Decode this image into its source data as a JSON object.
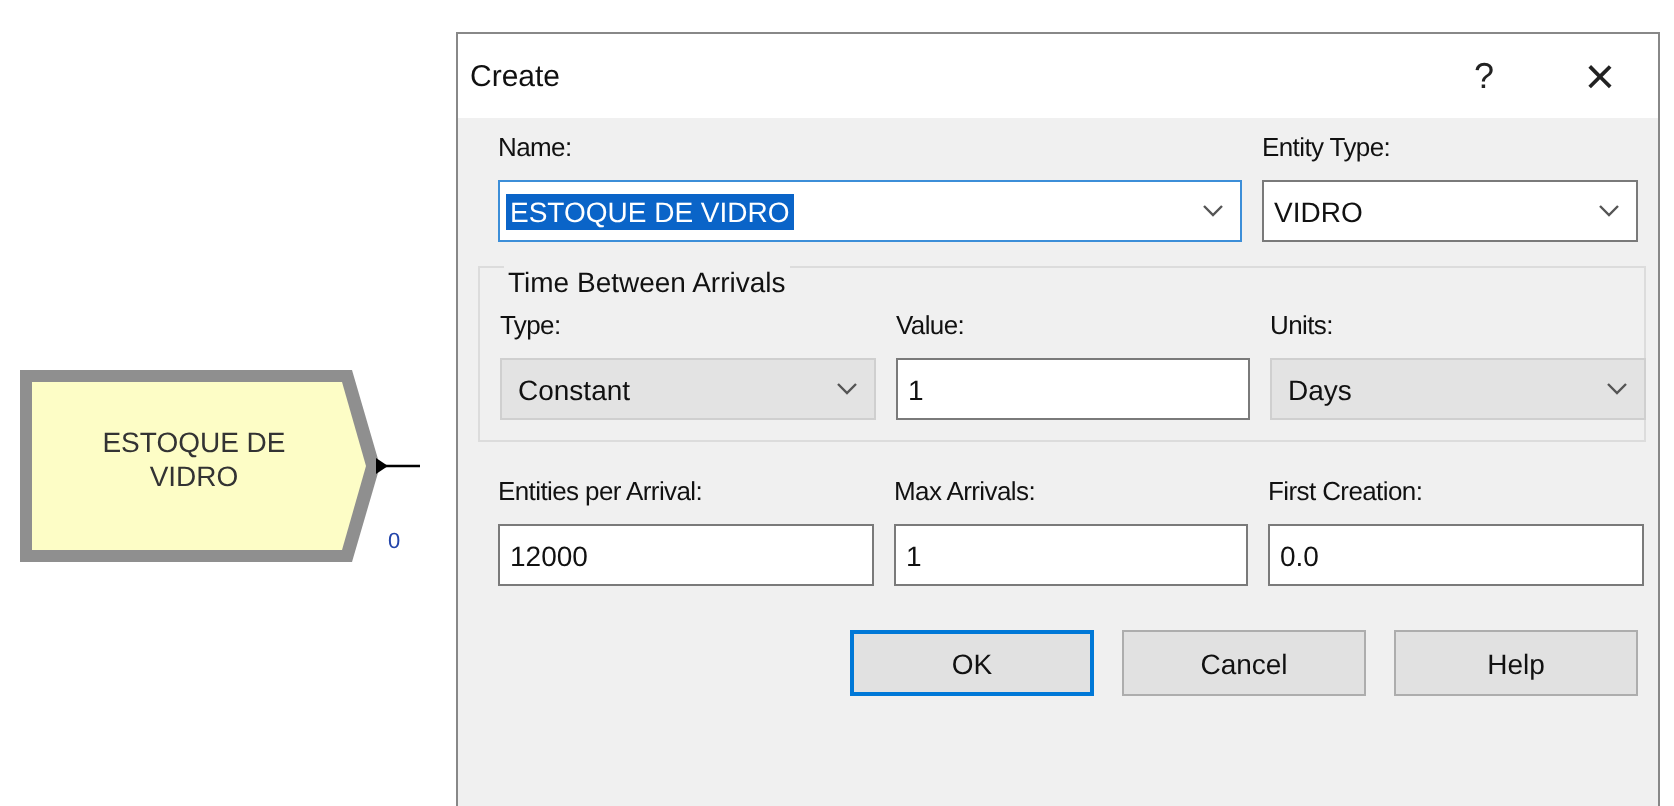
{
  "diagram": {
    "module": {
      "label": "ESTOQUE DE VIDRO",
      "count": "0"
    }
  },
  "dialog": {
    "title": "Create",
    "help_button": "?",
    "close_button": "×",
    "top_fields": [
      {
        "label": "Name:",
        "value": "ESTOQUE DE VIDRO",
        "kind": "combo",
        "selected": true
      },
      {
        "label": "Entity Type:",
        "value": "VIDRO",
        "kind": "combo",
        "selected": false
      }
    ],
    "group": {
      "title": "Time Between Arrivals",
      "fields": [
        {
          "label": "Type:",
          "value": "Constant",
          "kind": "dropdown",
          "selected": false
        },
        {
          "label": "Value:",
          "value": "1",
          "kind": "text",
          "selected": false
        },
        {
          "label": "Units:",
          "value": "Days",
          "kind": "dropdown",
          "selected": false
        }
      ]
    },
    "bottom_fields": [
      {
        "label": "Entities per Arrival:",
        "value": "12000",
        "kind": "text",
        "selected": false
      },
      {
        "label": "Max Arrivals:",
        "value": "1",
        "kind": "text",
        "selected": false
      },
      {
        "label": "First Creation:",
        "value": "0.0",
        "kind": "text",
        "selected": false
      }
    ],
    "buttons": [
      {
        "label": "OK",
        "default": true
      },
      {
        "label": "Cancel",
        "default": false
      },
      {
        "label": "Help",
        "default": false
      }
    ]
  }
}
